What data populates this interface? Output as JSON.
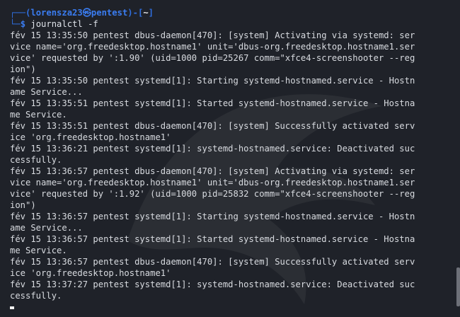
{
  "prompt": {
    "top_open": "┌──(",
    "user": "lorensza23",
    "at": "㉿",
    "host": "pentest",
    "mid": ")-[",
    "path": "~",
    "top_close": "]",
    "bottom_prefix": "└─",
    "dollar": "$",
    "command": "journalctl -f"
  },
  "log_lines": [
    "fév 15 13:35:50 pentest dbus-daemon[470]: [system] Activating via systemd: ser",
    "vice name='org.freedesktop.hostname1' unit='dbus-org.freedesktop.hostname1.ser",
    "vice' requested by ':1.90' (uid=1000 pid=25267 comm=\"xfce4-screenshooter --reg",
    "ion\")",
    "fév 15 13:35:50 pentest systemd[1]: Starting systemd-hostnamed.service - Hostn",
    "ame Service...",
    "fév 15 13:35:51 pentest systemd[1]: Started systemd-hostnamed.service - Hostna",
    "me Service.",
    "fév 15 13:35:51 pentest dbus-daemon[470]: [system] Successfully activated serv",
    "ice 'org.freedesktop.hostname1'",
    "fév 15 13:36:21 pentest systemd[1]: systemd-hostnamed.service: Deactivated suc",
    "cessfully.",
    "fév 15 13:36:57 pentest dbus-daemon[470]: [system] Activating via systemd: ser",
    "vice name='org.freedesktop.hostname1' unit='dbus-org.freedesktop.hostname1.ser",
    "vice' requested by ':1.92' (uid=1000 pid=25832 comm=\"xfce4-screenshooter --reg",
    "ion\")",
    "fév 15 13:36:57 pentest systemd[1]: Starting systemd-hostnamed.service - Hostn",
    "ame Service...",
    "fév 15 13:36:57 pentest systemd[1]: Started systemd-hostnamed.service - Hostna",
    "me Service.",
    "fév 15 13:36:57 pentest dbus-daemon[470]: [system] Successfully activated serv",
    "ice 'org.freedesktop.hostname1'",
    "fév 15 13:37:27 pentest systemd[1]: systemd-hostnamed.service: Deactivated suc",
    "cessfully."
  ],
  "colors": {
    "background": "#1f2229",
    "prompt_blue": "#3a7cf0",
    "text": "#d8dbe0"
  }
}
